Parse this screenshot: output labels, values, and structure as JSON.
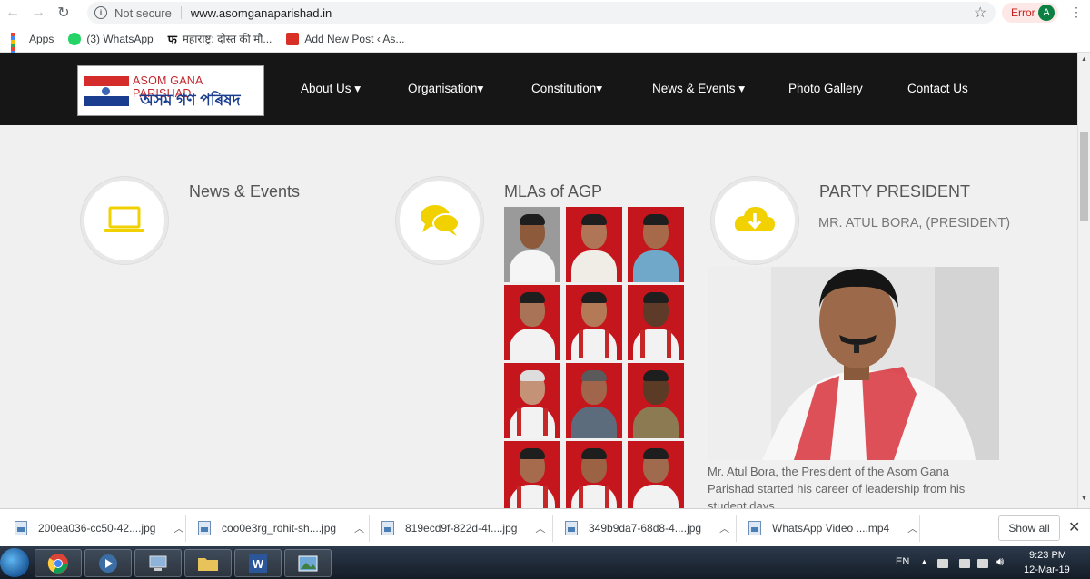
{
  "browser": {
    "security_label": "Not secure",
    "url": "www.asomganaparishad.in",
    "error_label": "Error",
    "avatar_letter": "A"
  },
  "bookmarks": [
    {
      "label": "Apps",
      "icon": "apps-grid-icon"
    },
    {
      "label": "(3) WhatsApp",
      "icon": "whatsapp-icon"
    },
    {
      "label": "महाराष्ट्र: दोस्त की मौ...",
      "icon": "fb-logo-icon"
    },
    {
      "label": "Add New Post ‹ As...",
      "icon": "blog-icon"
    }
  ],
  "site": {
    "logo_en": "ASOM GANA PARISHAD",
    "logo_as": "অসম গণ পৰিষদ",
    "nav": [
      "About Us ▾",
      "Organisation▾",
      "Constitution▾",
      "News & Events ▾",
      "Photo Gallery",
      "Contact Us"
    ]
  },
  "columns": {
    "news_title": "News & Events",
    "mla_title": "MLAs of AGP",
    "president_title": "PARTY PRESIDENT",
    "president_name": "MR. ATUL BORA, (PRESIDENT)",
    "president_text": "Mr. Atul Bora, the President of the Asom Gana Parishad started his career of leadership from his student days."
  },
  "downloads": {
    "files": [
      "200ea036-cc50-42....jpg",
      "coo0e3rg_rohit-sh....jpg",
      "819ecd9f-822d-4f....jpg",
      "349b9da7-68d8-4....jpg",
      "WhatsApp Video ....mp4"
    ],
    "show_all": "Show all"
  },
  "taskbar": {
    "lang": "EN",
    "time": "9:23 PM",
    "date": "12-Mar-19"
  },
  "colors": {
    "accent_yellow": "#f2d100",
    "header_bg": "#161616",
    "flag_red": "#d42b2b",
    "flag_blue": "#1a3d8f"
  }
}
